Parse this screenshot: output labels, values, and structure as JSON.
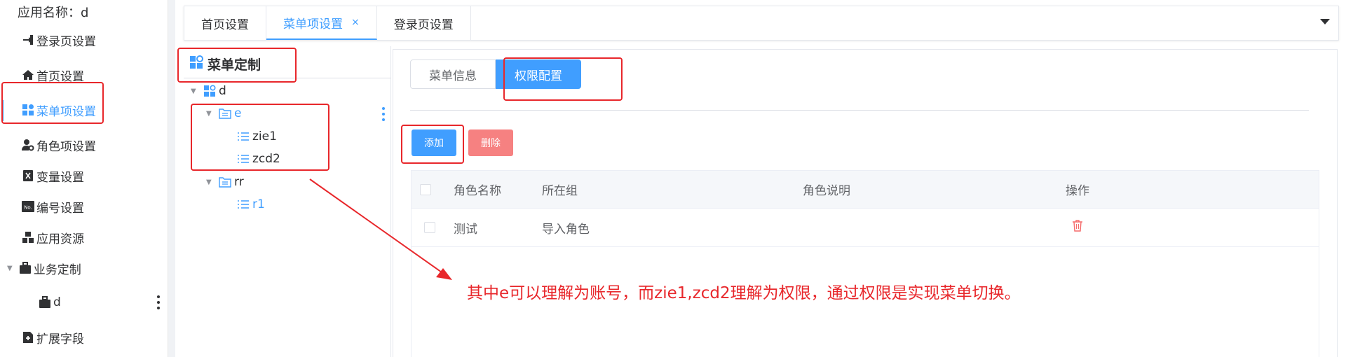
{
  "sidebar": {
    "app_name": "应用名称：d",
    "items": [
      {
        "label": "登录页设置",
        "icon": "login-icon"
      },
      {
        "label": "首页设置",
        "icon": "home-icon"
      },
      {
        "label": "菜单项设置",
        "icon": "grid-icon"
      },
      {
        "label": "角色项设置",
        "icon": "user-gear-icon"
      },
      {
        "label": "变量设置",
        "icon": "variable-icon"
      },
      {
        "label": "编号设置",
        "icon": "number-icon"
      },
      {
        "label": "应用资源",
        "icon": "cubes-icon"
      },
      {
        "label": "业务定制",
        "icon": "briefcase-icon"
      },
      {
        "label": "d",
        "icon": "briefcase-icon"
      },
      {
        "label": "扩展字段",
        "icon": "extend-icon"
      }
    ]
  },
  "tabs": [
    {
      "label": "首页设置"
    },
    {
      "label": "菜单项设置",
      "close": "×"
    },
    {
      "label": "登录页设置"
    }
  ],
  "tree": {
    "title": "菜单定制",
    "nodes": [
      {
        "label": "d"
      },
      {
        "label": "e"
      },
      {
        "label": "zie1"
      },
      {
        "label": "zcd2"
      },
      {
        "label": "rr"
      },
      {
        "label": "r1"
      }
    ]
  },
  "content": {
    "subtabs": [
      {
        "label": "菜单信息"
      },
      {
        "label": "权限配置"
      }
    ],
    "add_label": "添加",
    "delete_label": "删除",
    "table": {
      "headers": [
        "角色名称",
        "所在组",
        "角色说明",
        "操作"
      ],
      "rows": [
        {
          "name": "测试",
          "group": "导入角色",
          "desc": ""
        }
      ]
    }
  },
  "annotation": "其中e可以理解为账号，而zie1,zcd2理解为权限，通过权限是实现菜单切换。",
  "colors": {
    "accent": "#409eff",
    "danger": "#f56c6c",
    "highlight": "#e8272b"
  }
}
